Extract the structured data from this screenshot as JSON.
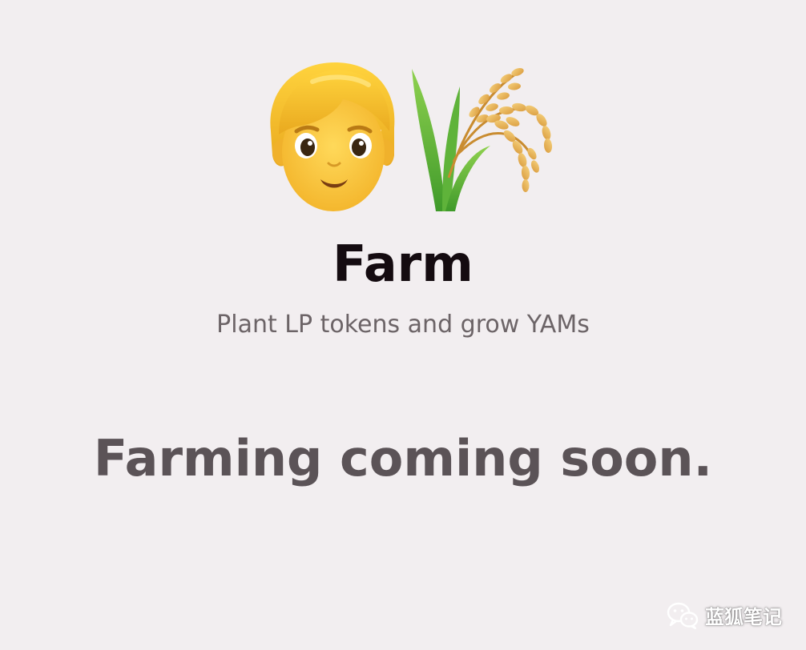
{
  "hero": {
    "icons": [
      "person-emoji",
      "rice-sheaf-emoji"
    ]
  },
  "page": {
    "title": "Farm",
    "subtitle": "Plant LP tokens and grow YAMs",
    "status_message": "Farming coming soon."
  },
  "watermark": {
    "icon": "wechat-icon",
    "text": "蓝狐笔记"
  },
  "colors": {
    "background": "#f2eef0",
    "title": "#140b10",
    "subtitle": "#6c6467",
    "status": "#5b5357"
  }
}
